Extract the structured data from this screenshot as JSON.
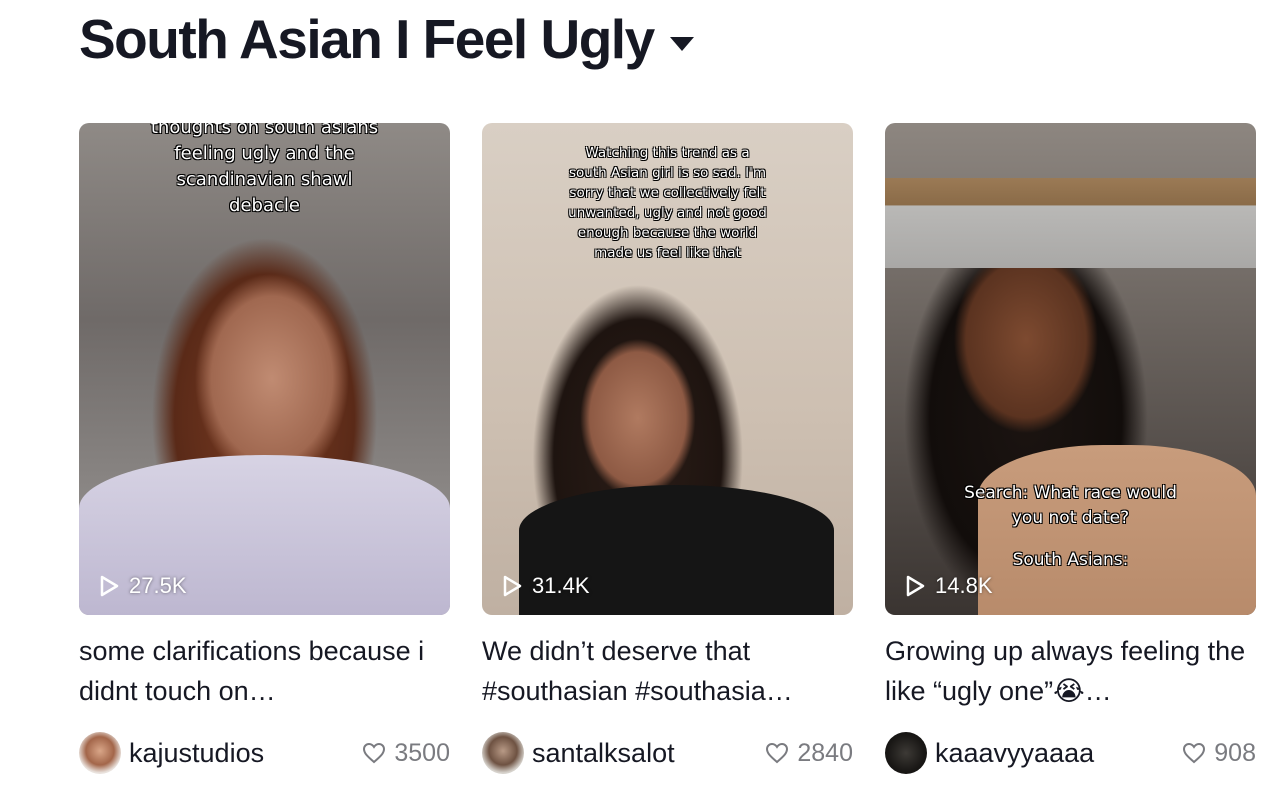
{
  "header": {
    "title": "South Asian I Feel Ugly",
    "dropdown_icon": "caret-down-icon"
  },
  "videos": [
    {
      "overlay_text": "thoughts on south asians\nfeeling ugly and the\nscandinavian shawl\ndebacle",
      "play_count": "27.5K",
      "description": "some clarifications because i didnt touch on…",
      "username": "kajustudios",
      "likes": "3500"
    },
    {
      "overlay_text": "Watching this trend as a\nsouth Asian girl is so sad. I'm\nsorry that we collectively felt\nunwanted, ugly and not good\nenough because the world\nmade us feel like that",
      "play_count": "31.4K",
      "description": "We didn’t deserve that #southasian #southasia…",
      "username": "santalksalot",
      "likes": "2840"
    },
    {
      "overlay_text": "Search: What race would\nyou not date?",
      "overlay_text_2": "South Asians:",
      "play_count": "14.8K",
      "description": "Growing up always feeling the like “ugly one”😭…",
      "username": "kaaavyyaaaa",
      "likes": "908"
    }
  ],
  "icons": {
    "play": "play-icon",
    "like": "heart-icon"
  }
}
